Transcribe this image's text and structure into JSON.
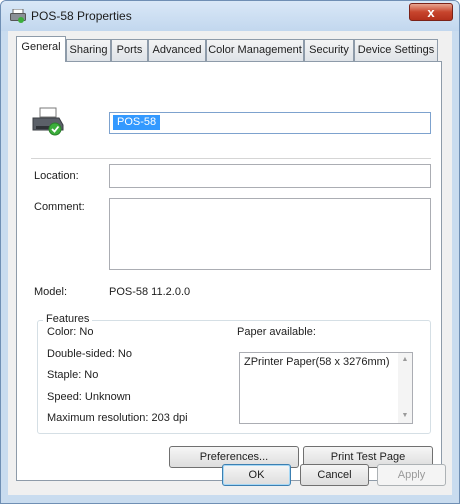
{
  "window": {
    "title": "POS-58 Properties",
    "close_glyph": "x"
  },
  "tabs": [
    {
      "label": "General",
      "active": true
    },
    {
      "label": "Sharing"
    },
    {
      "label": "Ports"
    },
    {
      "label": "Advanced"
    },
    {
      "label": "Color Management"
    },
    {
      "label": "Security"
    },
    {
      "label": "Device Settings"
    }
  ],
  "general": {
    "printer_icon": "printer-icon",
    "printer_name": "POS-58",
    "location_label": "Location:",
    "location_value": "",
    "comment_label": "Comment:",
    "comment_value": "",
    "model_label": "Model:",
    "model_value": "POS-58 11.2.0.0"
  },
  "features": {
    "legend": "Features",
    "color": "Color: No",
    "double_sided": "Double-sided: No",
    "staple": "Staple: No",
    "speed": "Speed: Unknown",
    "max_resolution": "Maximum resolution: 203 dpi",
    "paper_label": "Paper available:",
    "paper_items": [
      "ZPrinter Paper(58 x 3276mm)"
    ]
  },
  "actions": {
    "preferences": "Preferences...",
    "print_test_page": "Print Test Page"
  },
  "footer": {
    "ok": "OK",
    "cancel": "Cancel",
    "apply": "Apply"
  },
  "colors": {
    "title_bar": "#c9dcef",
    "selection": "#3399ff",
    "close_button": "#c7452d"
  }
}
